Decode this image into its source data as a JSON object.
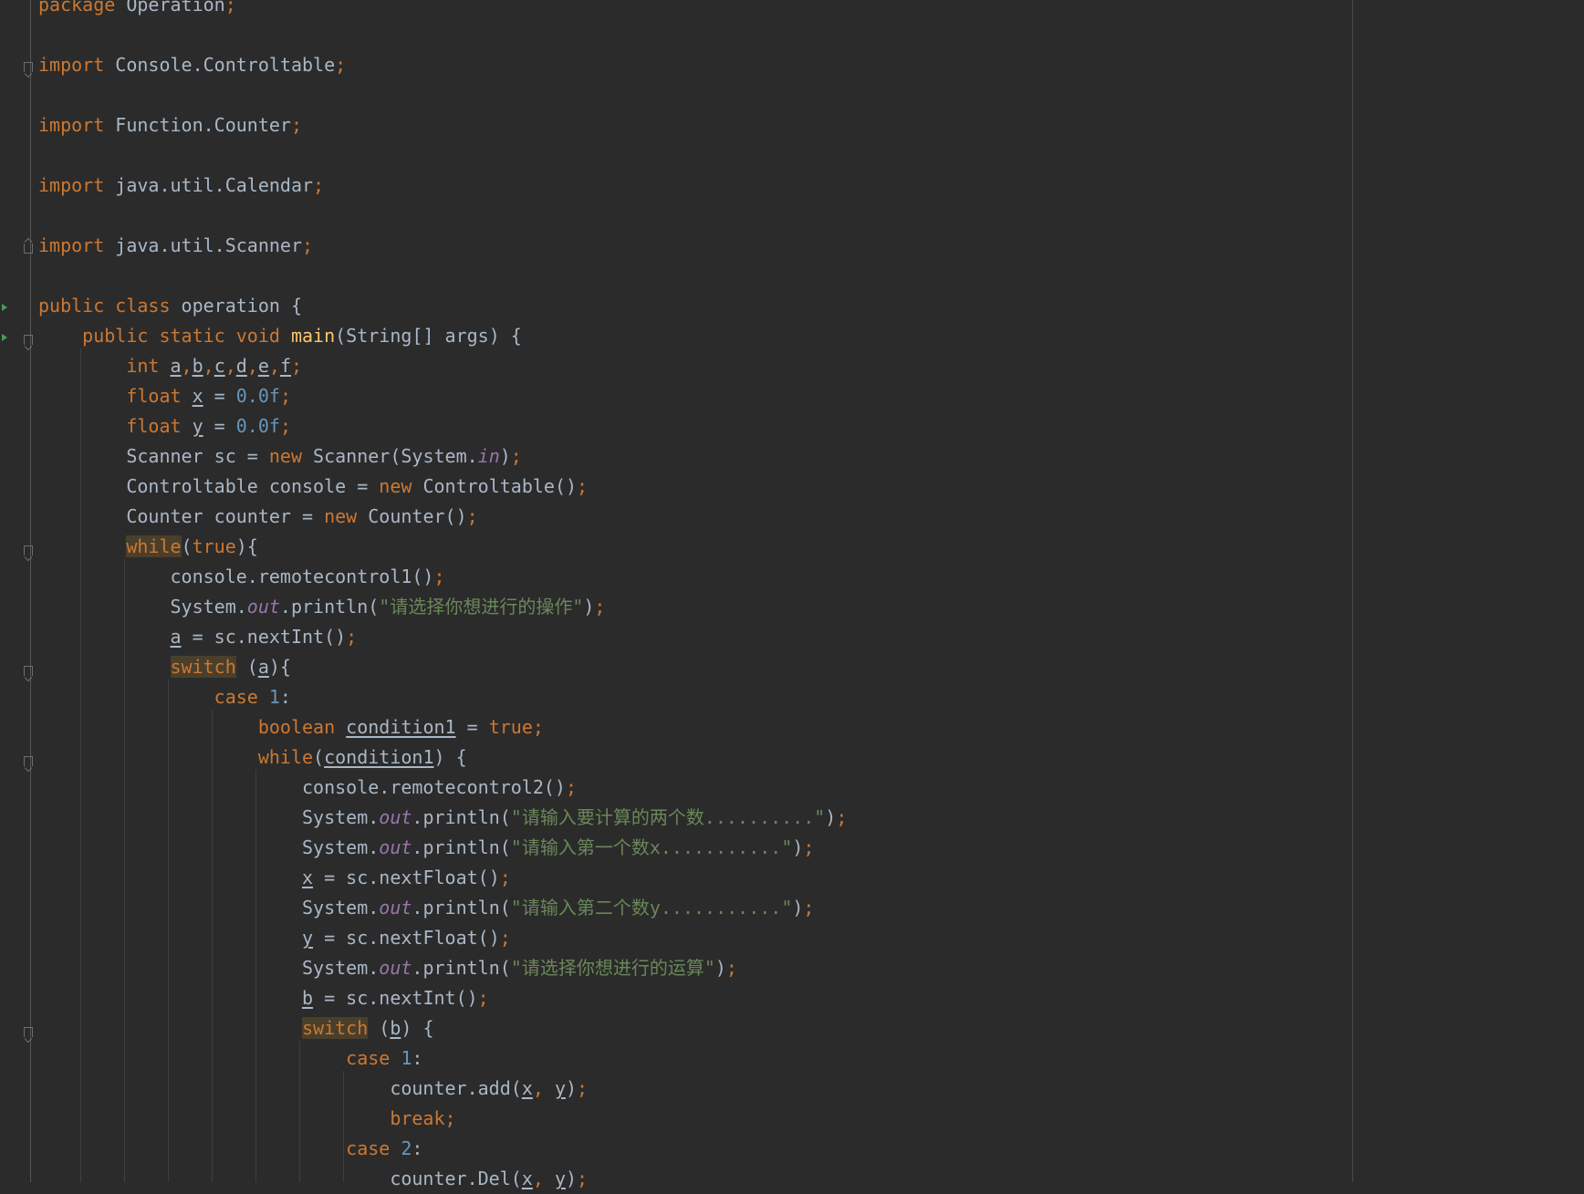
{
  "theme": {
    "background": "#2b2b2b",
    "keyword": "#cc7832",
    "number": "#6897bb",
    "string": "#6a8759",
    "field": "#9876aa",
    "function": "#ffc66d"
  },
  "editor": {
    "lines": [
      [
        {
          "t": "package",
          "c": "kw"
        },
        {
          "t": " Operation"
        },
        {
          "t": ";",
          "c": "kw"
        }
      ],
      [],
      [
        {
          "t": "import",
          "c": "kw"
        },
        {
          "t": " Console.Controltable"
        },
        {
          "t": ";",
          "c": "kw"
        }
      ],
      [],
      [
        {
          "t": "import",
          "c": "kw"
        },
        {
          "t": " Function.Counter"
        },
        {
          "t": ";",
          "c": "kw"
        }
      ],
      [],
      [
        {
          "t": "import",
          "c": "kw"
        },
        {
          "t": " java.util.Calendar"
        },
        {
          "t": ";",
          "c": "kw"
        }
      ],
      [],
      [
        {
          "t": "import",
          "c": "kw"
        },
        {
          "t": " java.util.Scanner"
        },
        {
          "t": ";",
          "c": "kw"
        }
      ],
      [],
      [
        {
          "t": "public class",
          "c": "kw"
        },
        {
          "t": " operation {"
        }
      ],
      [
        {
          "t": "    "
        },
        {
          "t": "public static void",
          "c": "kw"
        },
        {
          "t": " "
        },
        {
          "t": "main",
          "c": "fn"
        },
        {
          "t": "(String[] args) {"
        }
      ],
      [
        {
          "t": "        "
        },
        {
          "t": "int",
          "c": "kw"
        },
        {
          "t": " "
        },
        {
          "t": "a",
          "c": "u"
        },
        {
          "t": ",",
          "c": "kw"
        },
        {
          "t": "b",
          "c": "u"
        },
        {
          "t": ",",
          "c": "kw"
        },
        {
          "t": "c",
          "c": "u"
        },
        {
          "t": ",",
          "c": "kw"
        },
        {
          "t": "d",
          "c": "u"
        },
        {
          "t": ",",
          "c": "kw"
        },
        {
          "t": "e",
          "c": "u"
        },
        {
          "t": ",",
          "c": "kw"
        },
        {
          "t": "f",
          "c": "u"
        },
        {
          "t": ";",
          "c": "kw"
        }
      ],
      [
        {
          "t": "        "
        },
        {
          "t": "float",
          "c": "kw"
        },
        {
          "t": " "
        },
        {
          "t": "x",
          "c": "u"
        },
        {
          "t": " = "
        },
        {
          "t": "0.0f",
          "c": "num"
        },
        {
          "t": ";",
          "c": "kw"
        }
      ],
      [
        {
          "t": "        "
        },
        {
          "t": "float",
          "c": "kw"
        },
        {
          "t": " "
        },
        {
          "t": "y",
          "c": "u"
        },
        {
          "t": " = "
        },
        {
          "t": "0.0f",
          "c": "num"
        },
        {
          "t": ";",
          "c": "kw"
        }
      ],
      [
        {
          "t": "        Scanner sc = "
        },
        {
          "t": "new",
          "c": "kw"
        },
        {
          "t": " Scanner(System."
        },
        {
          "t": "in",
          "c": "fld"
        },
        {
          "t": ")"
        },
        {
          "t": ";",
          "c": "kw"
        }
      ],
      [
        {
          "t": "        Controltable console = "
        },
        {
          "t": "new",
          "c": "kw"
        },
        {
          "t": " Controltable()"
        },
        {
          "t": ";",
          "c": "kw"
        }
      ],
      [
        {
          "t": "        Counter counter = "
        },
        {
          "t": "new",
          "c": "kw"
        },
        {
          "t": " Counter()"
        },
        {
          "t": ";",
          "c": "kw"
        }
      ],
      [
        {
          "t": "        "
        },
        {
          "t": "while",
          "c": "kw hl"
        },
        {
          "t": "("
        },
        {
          "t": "true",
          "c": "kw"
        },
        {
          "t": "){"
        }
      ],
      [
        {
          "t": "            console.remotecontrol1()"
        },
        {
          "t": ";",
          "c": "kw"
        }
      ],
      [
        {
          "t": "            System."
        },
        {
          "t": "out",
          "c": "fld"
        },
        {
          "t": ".println("
        },
        {
          "t": "\"请选择你想进行的操作\"",
          "c": "str"
        },
        {
          "t": ")"
        },
        {
          "t": ";",
          "c": "kw"
        }
      ],
      [
        {
          "t": "            "
        },
        {
          "t": "a",
          "c": "u"
        },
        {
          "t": " = sc.nextInt()"
        },
        {
          "t": ";",
          "c": "kw"
        }
      ],
      [
        {
          "t": "            "
        },
        {
          "t": "switch",
          "c": "kw hl"
        },
        {
          "t": " ("
        },
        {
          "t": "a",
          "c": "u"
        },
        {
          "t": "){"
        }
      ],
      [
        {
          "t": "                "
        },
        {
          "t": "case",
          "c": "kw"
        },
        {
          "t": " "
        },
        {
          "t": "1",
          "c": "num"
        },
        {
          "t": ":"
        }
      ],
      [
        {
          "t": "                    "
        },
        {
          "t": "boolean",
          "c": "kw"
        },
        {
          "t": " "
        },
        {
          "t": "condition1",
          "c": "u"
        },
        {
          "t": " = "
        },
        {
          "t": "true",
          "c": "kw"
        },
        {
          "t": ";",
          "c": "kw"
        }
      ],
      [
        {
          "t": "                    "
        },
        {
          "t": "while",
          "c": "kw"
        },
        {
          "t": "("
        },
        {
          "t": "condition1",
          "c": "u"
        },
        {
          "t": ") {"
        }
      ],
      [
        {
          "t": "                        console.remotecontrol2()"
        },
        {
          "t": ";",
          "c": "kw"
        }
      ],
      [
        {
          "t": "                        System."
        },
        {
          "t": "out",
          "c": "fld"
        },
        {
          "t": ".println("
        },
        {
          "t": "\"请输入要计算的两个数..........\"",
          "c": "str"
        },
        {
          "t": ")"
        },
        {
          "t": ";",
          "c": "kw"
        }
      ],
      [
        {
          "t": "                        System."
        },
        {
          "t": "out",
          "c": "fld"
        },
        {
          "t": ".println("
        },
        {
          "t": "\"请输入第一个数x...........\"",
          "c": "str"
        },
        {
          "t": ")"
        },
        {
          "t": ";",
          "c": "kw"
        }
      ],
      [
        {
          "t": "                        "
        },
        {
          "t": "x",
          "c": "u"
        },
        {
          "t": " = sc.nextFloat()"
        },
        {
          "t": ";",
          "c": "kw"
        }
      ],
      [
        {
          "t": "                        System."
        },
        {
          "t": "out",
          "c": "fld"
        },
        {
          "t": ".println("
        },
        {
          "t": "\"请输入第二个数y...........\"",
          "c": "str"
        },
        {
          "t": ")"
        },
        {
          "t": ";",
          "c": "kw"
        }
      ],
      [
        {
          "t": "                        "
        },
        {
          "t": "y",
          "c": "u"
        },
        {
          "t": " = sc.nextFloat()"
        },
        {
          "t": ";",
          "c": "kw"
        }
      ],
      [
        {
          "t": "                        System."
        },
        {
          "t": "out",
          "c": "fld"
        },
        {
          "t": ".println("
        },
        {
          "t": "\"请选择你想进行的运算\"",
          "c": "str"
        },
        {
          "t": ")"
        },
        {
          "t": ";",
          "c": "kw"
        }
      ],
      [
        {
          "t": "                        "
        },
        {
          "t": "b",
          "c": "u"
        },
        {
          "t": " = sc.nextInt()"
        },
        {
          "t": ";",
          "c": "kw"
        }
      ],
      [
        {
          "t": "                        "
        },
        {
          "t": "switch",
          "c": "kw hl"
        },
        {
          "t": " ("
        },
        {
          "t": "b",
          "c": "u"
        },
        {
          "t": ") {"
        }
      ],
      [
        {
          "t": "                            "
        },
        {
          "t": "case",
          "c": "kw"
        },
        {
          "t": " "
        },
        {
          "t": "1",
          "c": "num"
        },
        {
          "t": ":"
        }
      ],
      [
        {
          "t": "                                counter.add("
        },
        {
          "t": "x",
          "c": "u"
        },
        {
          "t": ", ",
          "c": "kw"
        },
        {
          "t": "y",
          "c": "u"
        },
        {
          "t": ")"
        },
        {
          "t": ";",
          "c": "kw"
        }
      ],
      [
        {
          "t": "                                "
        },
        {
          "t": "break",
          "c": "kw"
        },
        {
          "t": ";",
          "c": "kw"
        }
      ],
      [
        {
          "t": "                            "
        },
        {
          "t": "case",
          "c": "kw"
        },
        {
          "t": " "
        },
        {
          "t": "2",
          "c": "num"
        },
        {
          "t": ":"
        }
      ],
      [
        {
          "t": "                                counter.Del("
        },
        {
          "t": "x",
          "c": "u"
        },
        {
          "t": ", ",
          "c": "kw"
        },
        {
          "t": "y",
          "c": "u"
        },
        {
          "t": ")"
        },
        {
          "t": ";",
          "c": "kw"
        }
      ]
    ]
  }
}
